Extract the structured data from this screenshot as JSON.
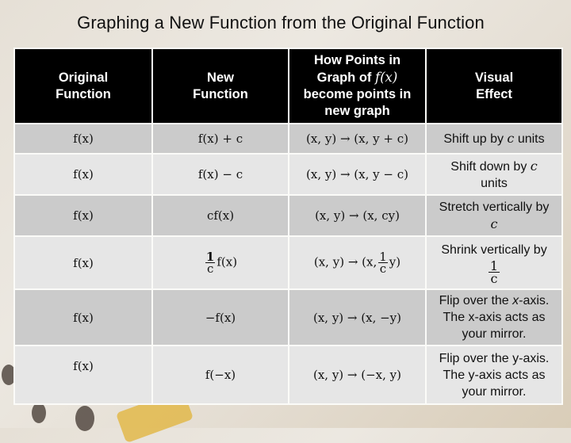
{
  "title": "Graphing a New Function from the Original Function",
  "table": {
    "headers": [
      "Original Function",
      "New Function",
      "How Points in Graph of f(x) become points in new graph",
      "Visual Effect"
    ],
    "header_parts": {
      "col1_line1": "Original",
      "col1_line2": "Function",
      "col2_line1": "New",
      "col2_line2": "Function",
      "col3_line1": "How Points in",
      "col3_line2a": "Graph of ",
      "col3_fx": "f(x)",
      "col3_line3": "become points in",
      "col3_line4": "new graph",
      "col4_line1": "Visual",
      "col4_line2": "Effect"
    },
    "rows": [
      {
        "original": "f(x)",
        "new": "f(x) + c",
        "mapping": "(x, y) → (x, y + c)",
        "effect_a": "Shift up by ",
        "effect_var": "c",
        "effect_b": " units"
      },
      {
        "original": "f(x)",
        "new": "f(x) − c",
        "mapping": "(x, y) → (x, y − c)",
        "effect_a": "Shift down by ",
        "effect_var": "c",
        "effect_b": " units"
      },
      {
        "original": "f(x)",
        "new": "cf(x)",
        "mapping": "(x, y) → (x, cy)",
        "effect_a": "Stretch vertically by ",
        "effect_var": "c",
        "effect_b": ""
      },
      {
        "original": "f(x)",
        "new_num": "1",
        "new_den": "c",
        "new_rest": "f(x)",
        "mapping_a": "(x, y) → (x,",
        "mapping_num": "1",
        "mapping_den": "c",
        "mapping_b": "y)",
        "effect_a": "Shrink vertically by",
        "effect_num": "1",
        "effect_den": "c"
      },
      {
        "original": "f(x)",
        "new": "−f(x)",
        "mapping": "(x, y) → (x, −y)",
        "effect_a": "Flip over the ",
        "effect_var": "x",
        "effect_b": "-axis. The x-axis acts as your mirror."
      },
      {
        "original": "f(x)",
        "new": "f(−x)",
        "mapping": "(x, y) → (−x, y)",
        "effect_a": "Flip over the y-axis. The y-axis acts as your mirror.",
        "effect_var": "",
        "effect_b": ""
      }
    ]
  }
}
